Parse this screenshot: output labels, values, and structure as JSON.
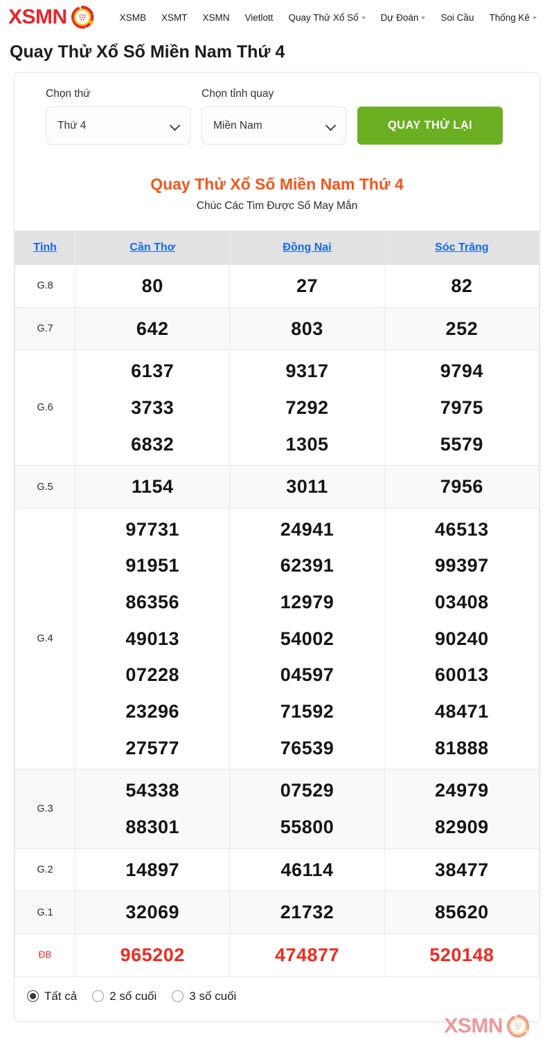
{
  "header": {
    "logo_text": "XSMN",
    "logo_icon": "lottery-ball-icon",
    "nav": [
      {
        "label": "XSMB",
        "has_caret": false
      },
      {
        "label": "XSMT",
        "has_caret": false
      },
      {
        "label": "XSMN",
        "has_caret": false
      },
      {
        "label": "Vietlott",
        "has_caret": false
      },
      {
        "label": "Quay Thử Xổ Số",
        "has_caret": true
      },
      {
        "label": "Dự Đoán",
        "has_caret": true
      },
      {
        "label": "Soi Cầu",
        "has_caret": false
      },
      {
        "label": "Thống Kê",
        "has_caret": true
      }
    ]
  },
  "page_title": "Quay Thử Xổ Số Miền Nam Thứ 4",
  "form": {
    "day_label": "Chọn thứ",
    "day_value": "Thứ 4",
    "province_label": "Chọn tỉnh quay",
    "province_value": "Miền Nam",
    "spin_button": "QUAY THỬ LẠI"
  },
  "result_heading": "Quay Thử Xổ Số Miền Nam Thứ 4",
  "result_subheading": "Chúc Các Tim Được Số May Mắn",
  "table": {
    "columns": [
      "Tỉnh",
      "Cần Thơ",
      "Đồng Nai",
      "Sóc Trăng"
    ],
    "rows": [
      {
        "prize": "G.8",
        "stripe": false,
        "values": [
          [
            "80"
          ],
          [
            "27"
          ],
          [
            "82"
          ]
        ]
      },
      {
        "prize": "G.7",
        "stripe": true,
        "values": [
          [
            "642"
          ],
          [
            "803"
          ],
          [
            "252"
          ]
        ]
      },
      {
        "prize": "G.6",
        "stripe": false,
        "values": [
          [
            "6137",
            "3733",
            "6832"
          ],
          [
            "9317",
            "7292",
            "1305"
          ],
          [
            "9794",
            "7975",
            "5579"
          ]
        ]
      },
      {
        "prize": "G.5",
        "stripe": true,
        "values": [
          [
            "1154"
          ],
          [
            "3011"
          ],
          [
            "7956"
          ]
        ]
      },
      {
        "prize": "G.4",
        "stripe": false,
        "values": [
          [
            "97731",
            "91951",
            "86356",
            "49013",
            "07228",
            "23296",
            "27577"
          ],
          [
            "24941",
            "62391",
            "12979",
            "54002",
            "04597",
            "71592",
            "76539"
          ],
          [
            "46513",
            "99397",
            "03408",
            "90240",
            "60013",
            "48471",
            "81888"
          ]
        ]
      },
      {
        "prize": "G.3",
        "stripe": true,
        "values": [
          [
            "54338",
            "88301"
          ],
          [
            "07529",
            "55800"
          ],
          [
            "24979",
            "82909"
          ]
        ]
      },
      {
        "prize": "G.2",
        "stripe": false,
        "values": [
          [
            "14897"
          ],
          [
            "46114"
          ],
          [
            "38477"
          ]
        ]
      },
      {
        "prize": "G.1",
        "stripe": true,
        "values": [
          [
            "32069"
          ],
          [
            "21732"
          ],
          [
            "85620"
          ]
        ]
      },
      {
        "prize": "ĐB",
        "stripe": false,
        "special": true,
        "values": [
          [
            "965202"
          ],
          [
            "474877"
          ],
          [
            "520148"
          ]
        ]
      }
    ]
  },
  "filters": [
    {
      "label": "Tất cả",
      "selected": true
    },
    {
      "label": "2 số cuối",
      "selected": false
    },
    {
      "label": "3 số cuối",
      "selected": false
    }
  ],
  "watermark": {
    "text": "XSMN",
    "icon": "lottery-ball-icon"
  },
  "colors": {
    "brand_red": "#e8252a",
    "accent_orange": "#f2551b",
    "link_blue": "#1667f2",
    "button_green": "#6aaf21",
    "special_red": "#ef2b20",
    "header_gray": "#e2e2e2"
  }
}
